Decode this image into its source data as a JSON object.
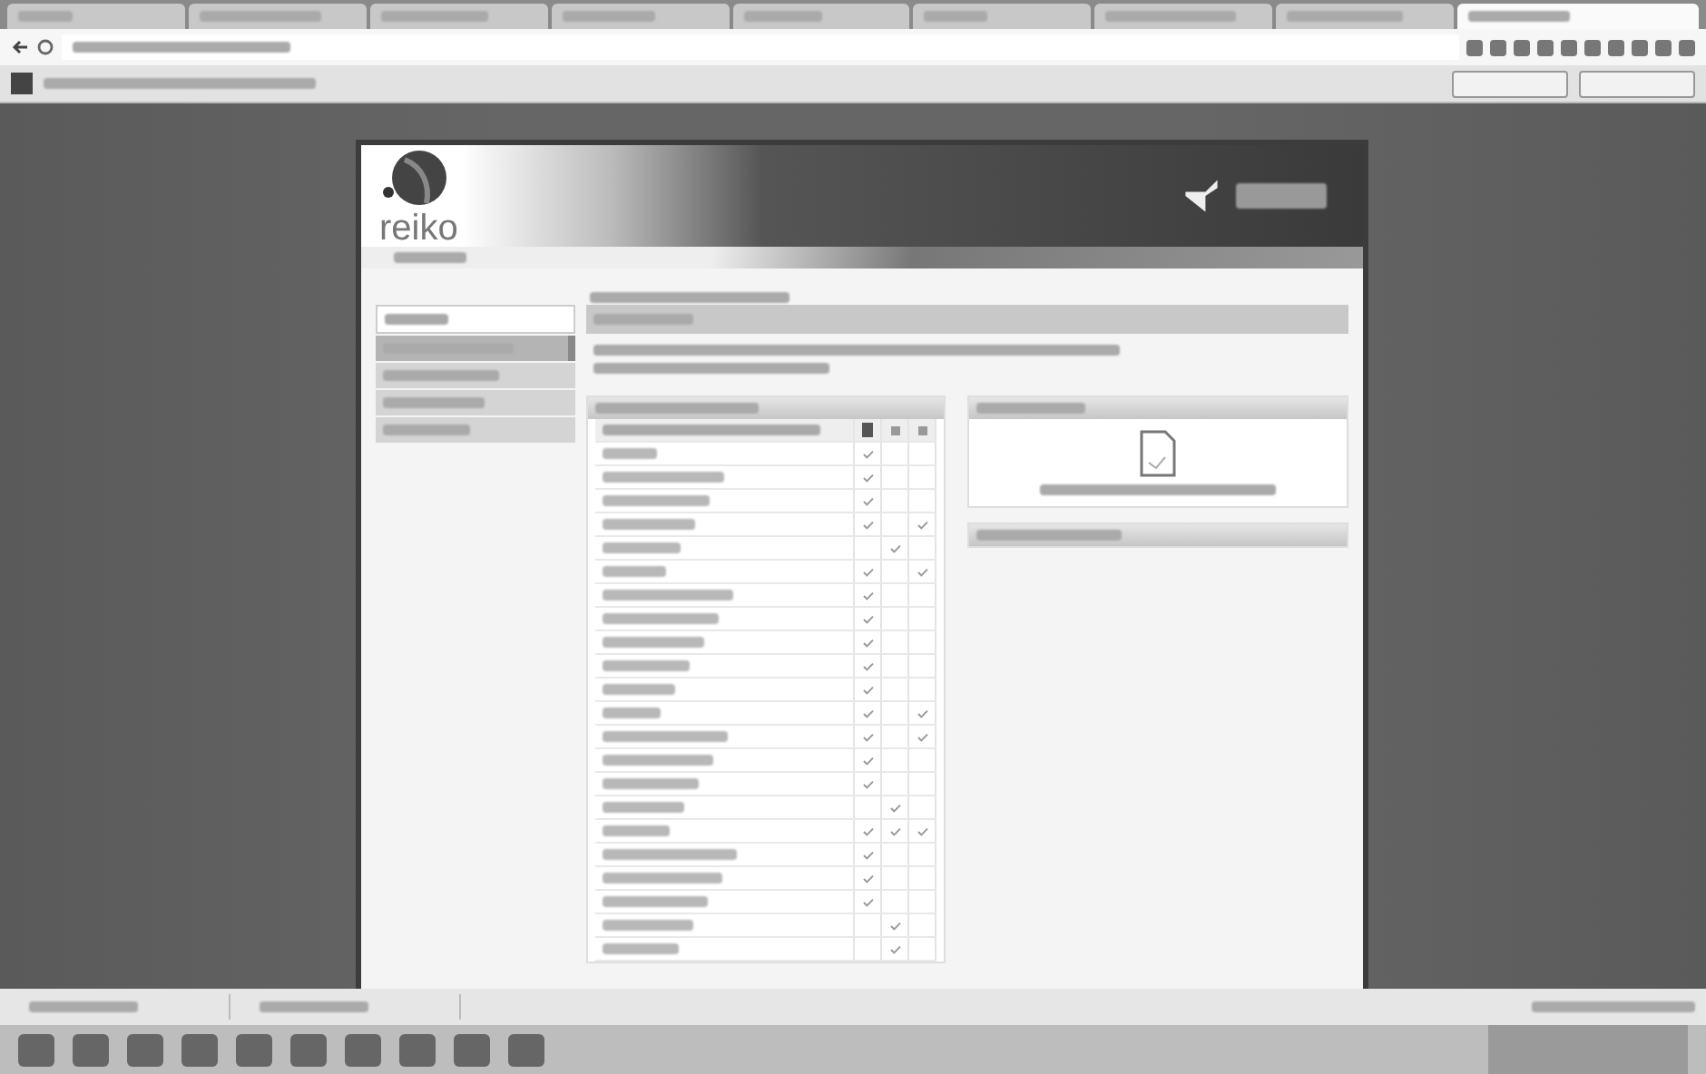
{
  "browser": {
    "tabs": [
      {
        "selected": false
      },
      {
        "selected": false
      },
      {
        "selected": false
      },
      {
        "selected": false
      },
      {
        "selected": false
      },
      {
        "selected": false
      },
      {
        "selected": false
      },
      {
        "selected": false
      },
      {
        "selected": true
      }
    ]
  },
  "site": {
    "logo": "reiko"
  },
  "sidebar": {
    "items": [
      {
        "selected": false
      },
      {
        "selected": true
      },
      {
        "selected": false
      },
      {
        "selected": false
      },
      {
        "selected": false
      }
    ]
  },
  "table": {
    "rows": [
      {
        "marks": [
          true,
          false,
          false
        ]
      },
      {
        "marks": [
          true,
          false,
          false
        ]
      },
      {
        "marks": [
          true,
          false,
          false
        ]
      },
      {
        "marks": [
          true,
          false,
          true
        ]
      },
      {
        "marks": [
          false,
          true,
          false
        ]
      },
      {
        "marks": [
          true,
          false,
          true
        ]
      },
      {
        "marks": [
          true,
          false,
          false
        ]
      },
      {
        "marks": [
          true,
          false,
          false
        ]
      },
      {
        "marks": [
          true,
          false,
          false
        ]
      },
      {
        "marks": [
          true,
          false,
          false
        ]
      },
      {
        "marks": [
          true,
          false,
          false
        ]
      },
      {
        "marks": [
          true,
          false,
          true
        ]
      },
      {
        "marks": [
          true,
          false,
          true
        ]
      },
      {
        "marks": [
          true,
          false,
          false
        ]
      },
      {
        "marks": [
          true,
          false,
          false
        ]
      },
      {
        "marks": [
          false,
          true,
          false
        ]
      },
      {
        "marks": [
          true,
          true,
          true
        ]
      },
      {
        "marks": [
          true,
          false,
          false
        ]
      },
      {
        "marks": [
          true,
          false,
          false
        ]
      },
      {
        "marks": [
          true,
          false,
          false
        ]
      },
      {
        "marks": [
          false,
          true,
          false
        ]
      },
      {
        "marks": [
          false,
          true,
          false
        ]
      }
    ]
  },
  "taskbar": {
    "apps": [
      {
        "kind": "app"
      },
      {
        "kind": "app"
      },
      {
        "kind": "app"
      },
      {
        "kind": "app"
      },
      {
        "kind": "app"
      },
      {
        "kind": "app"
      },
      {
        "kind": "app"
      },
      {
        "kind": "app"
      },
      {
        "kind": "app"
      },
      {
        "kind": "app"
      }
    ]
  }
}
